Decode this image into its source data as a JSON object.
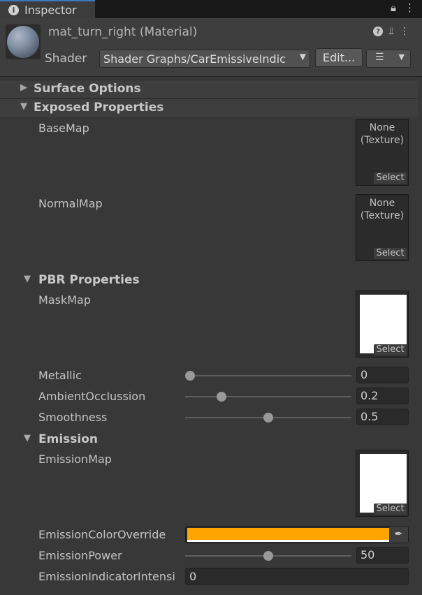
{
  "tab": {
    "title": "Inspector",
    "lock_icon": "lock-icon",
    "menu_icon": "kebab-icon"
  },
  "header": {
    "material_name": "mat_turn_right (Material)",
    "shader_label": "Shader",
    "shader_value": "Shader Graphs/CarEmissiveIndic",
    "edit_label": "Edit...",
    "icons": [
      "help-icon",
      "preset-icon",
      "kebab-icon"
    ]
  },
  "sections": {
    "surface_options": "Surface Options",
    "exposed_properties": "Exposed Properties",
    "pbr_properties": "PBR Properties",
    "emission": "Emission"
  },
  "props": {
    "base_map": {
      "label": "BaseMap",
      "value": "None\n(Texture)",
      "select": "Select"
    },
    "normal_map": {
      "label": "NormalMap",
      "value": "None\n(Texture)",
      "select": "Select"
    },
    "mask_map": {
      "label": "MaskMap",
      "select": "Select"
    },
    "metallic": {
      "label": "Metallic",
      "value": "0",
      "fraction": 0.0
    },
    "ambient_occlusion": {
      "label": "AmbientOcclussion",
      "value": "0.2",
      "fraction": 0.2
    },
    "smoothness": {
      "label": "Smoothness",
      "value": "0.5",
      "fraction": 0.5
    },
    "emission_map": {
      "label": "EmissionMap",
      "select": "Select"
    },
    "emission_color": {
      "label": "EmissionColorOverride",
      "color": "#ffa500"
    },
    "emission_power": {
      "label": "EmissionPower",
      "value": "50",
      "fraction": 0.5
    },
    "emission_indicator": {
      "label": "EmissionIndicatorIntensi",
      "value": "0"
    }
  }
}
